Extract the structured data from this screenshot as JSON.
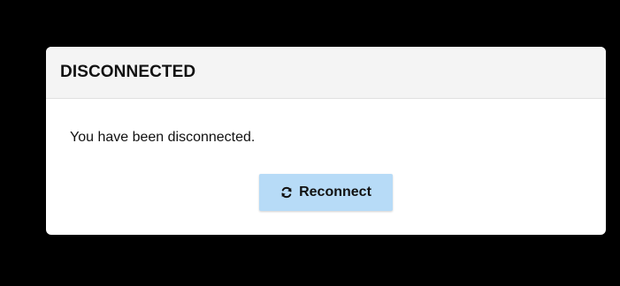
{
  "dialog": {
    "title": "DISCONNECTED",
    "message": "You have been disconnected.",
    "reconnect_button": {
      "label": "Reconnect",
      "icon": "refresh-icon",
      "color": "#b7dbf7"
    }
  },
  "colors": {
    "background": "#000000",
    "dialog_header": "#f4f4f4",
    "dialog_body": "#ffffff"
  }
}
